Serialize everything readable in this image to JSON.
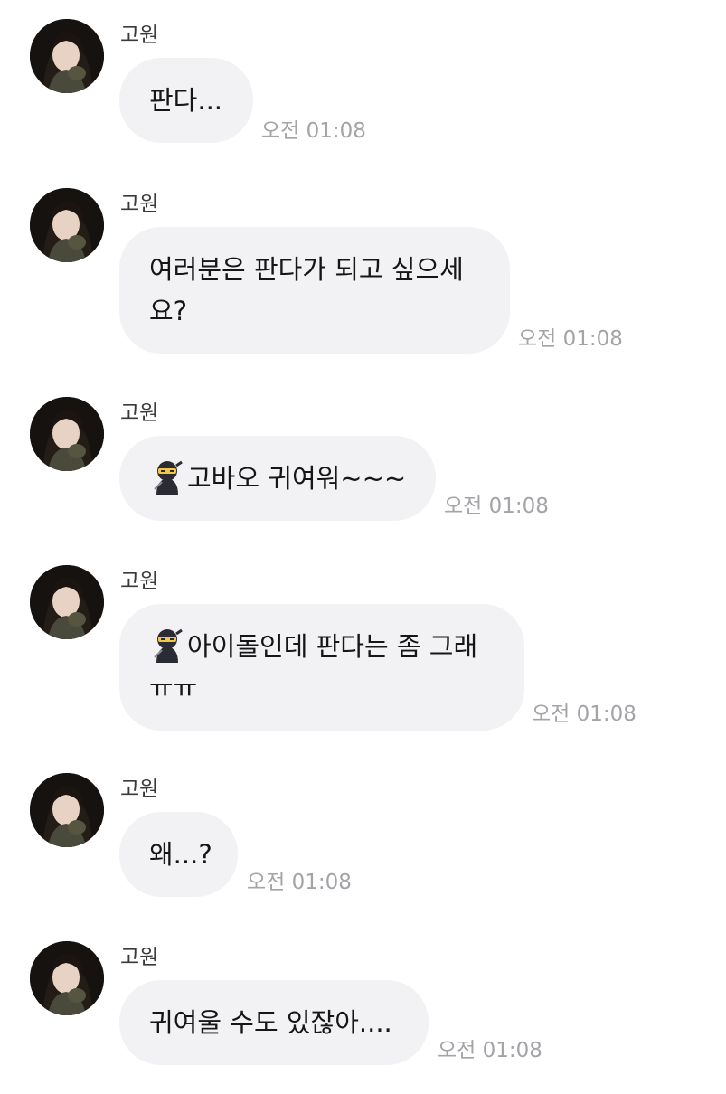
{
  "messages": [
    {
      "sender": "고원",
      "lines": [
        "판다..."
      ],
      "time": "오전 01:08",
      "emoji": ""
    },
    {
      "sender": "고원",
      "lines": [
        "여러분은 판다가 되고 싶으세",
        "요?"
      ],
      "time": "오전 01:08",
      "emoji": ""
    },
    {
      "sender": "고원",
      "lines": [
        "고바오 귀여워~~~"
      ],
      "time": "오전 01:08",
      "emoji": "ninja"
    },
    {
      "sender": "고원",
      "lines": [
        "아이돌인데 판다는 좀 그래",
        "ㅠㅠ"
      ],
      "time": "오전 01:08",
      "emoji": "ninja"
    },
    {
      "sender": "고원",
      "lines": [
        "왜...?"
      ],
      "time": "오전 01:08",
      "emoji": ""
    },
    {
      "sender": "고원",
      "lines": [
        "귀여울 수도 있잖아...."
      ],
      "time": "오전 01:08",
      "emoji": ""
    }
  ],
  "colors": {
    "bubble": "#f2f2f5",
    "timestamp": "#a3a3a8",
    "sender": "#3a3a3a"
  }
}
